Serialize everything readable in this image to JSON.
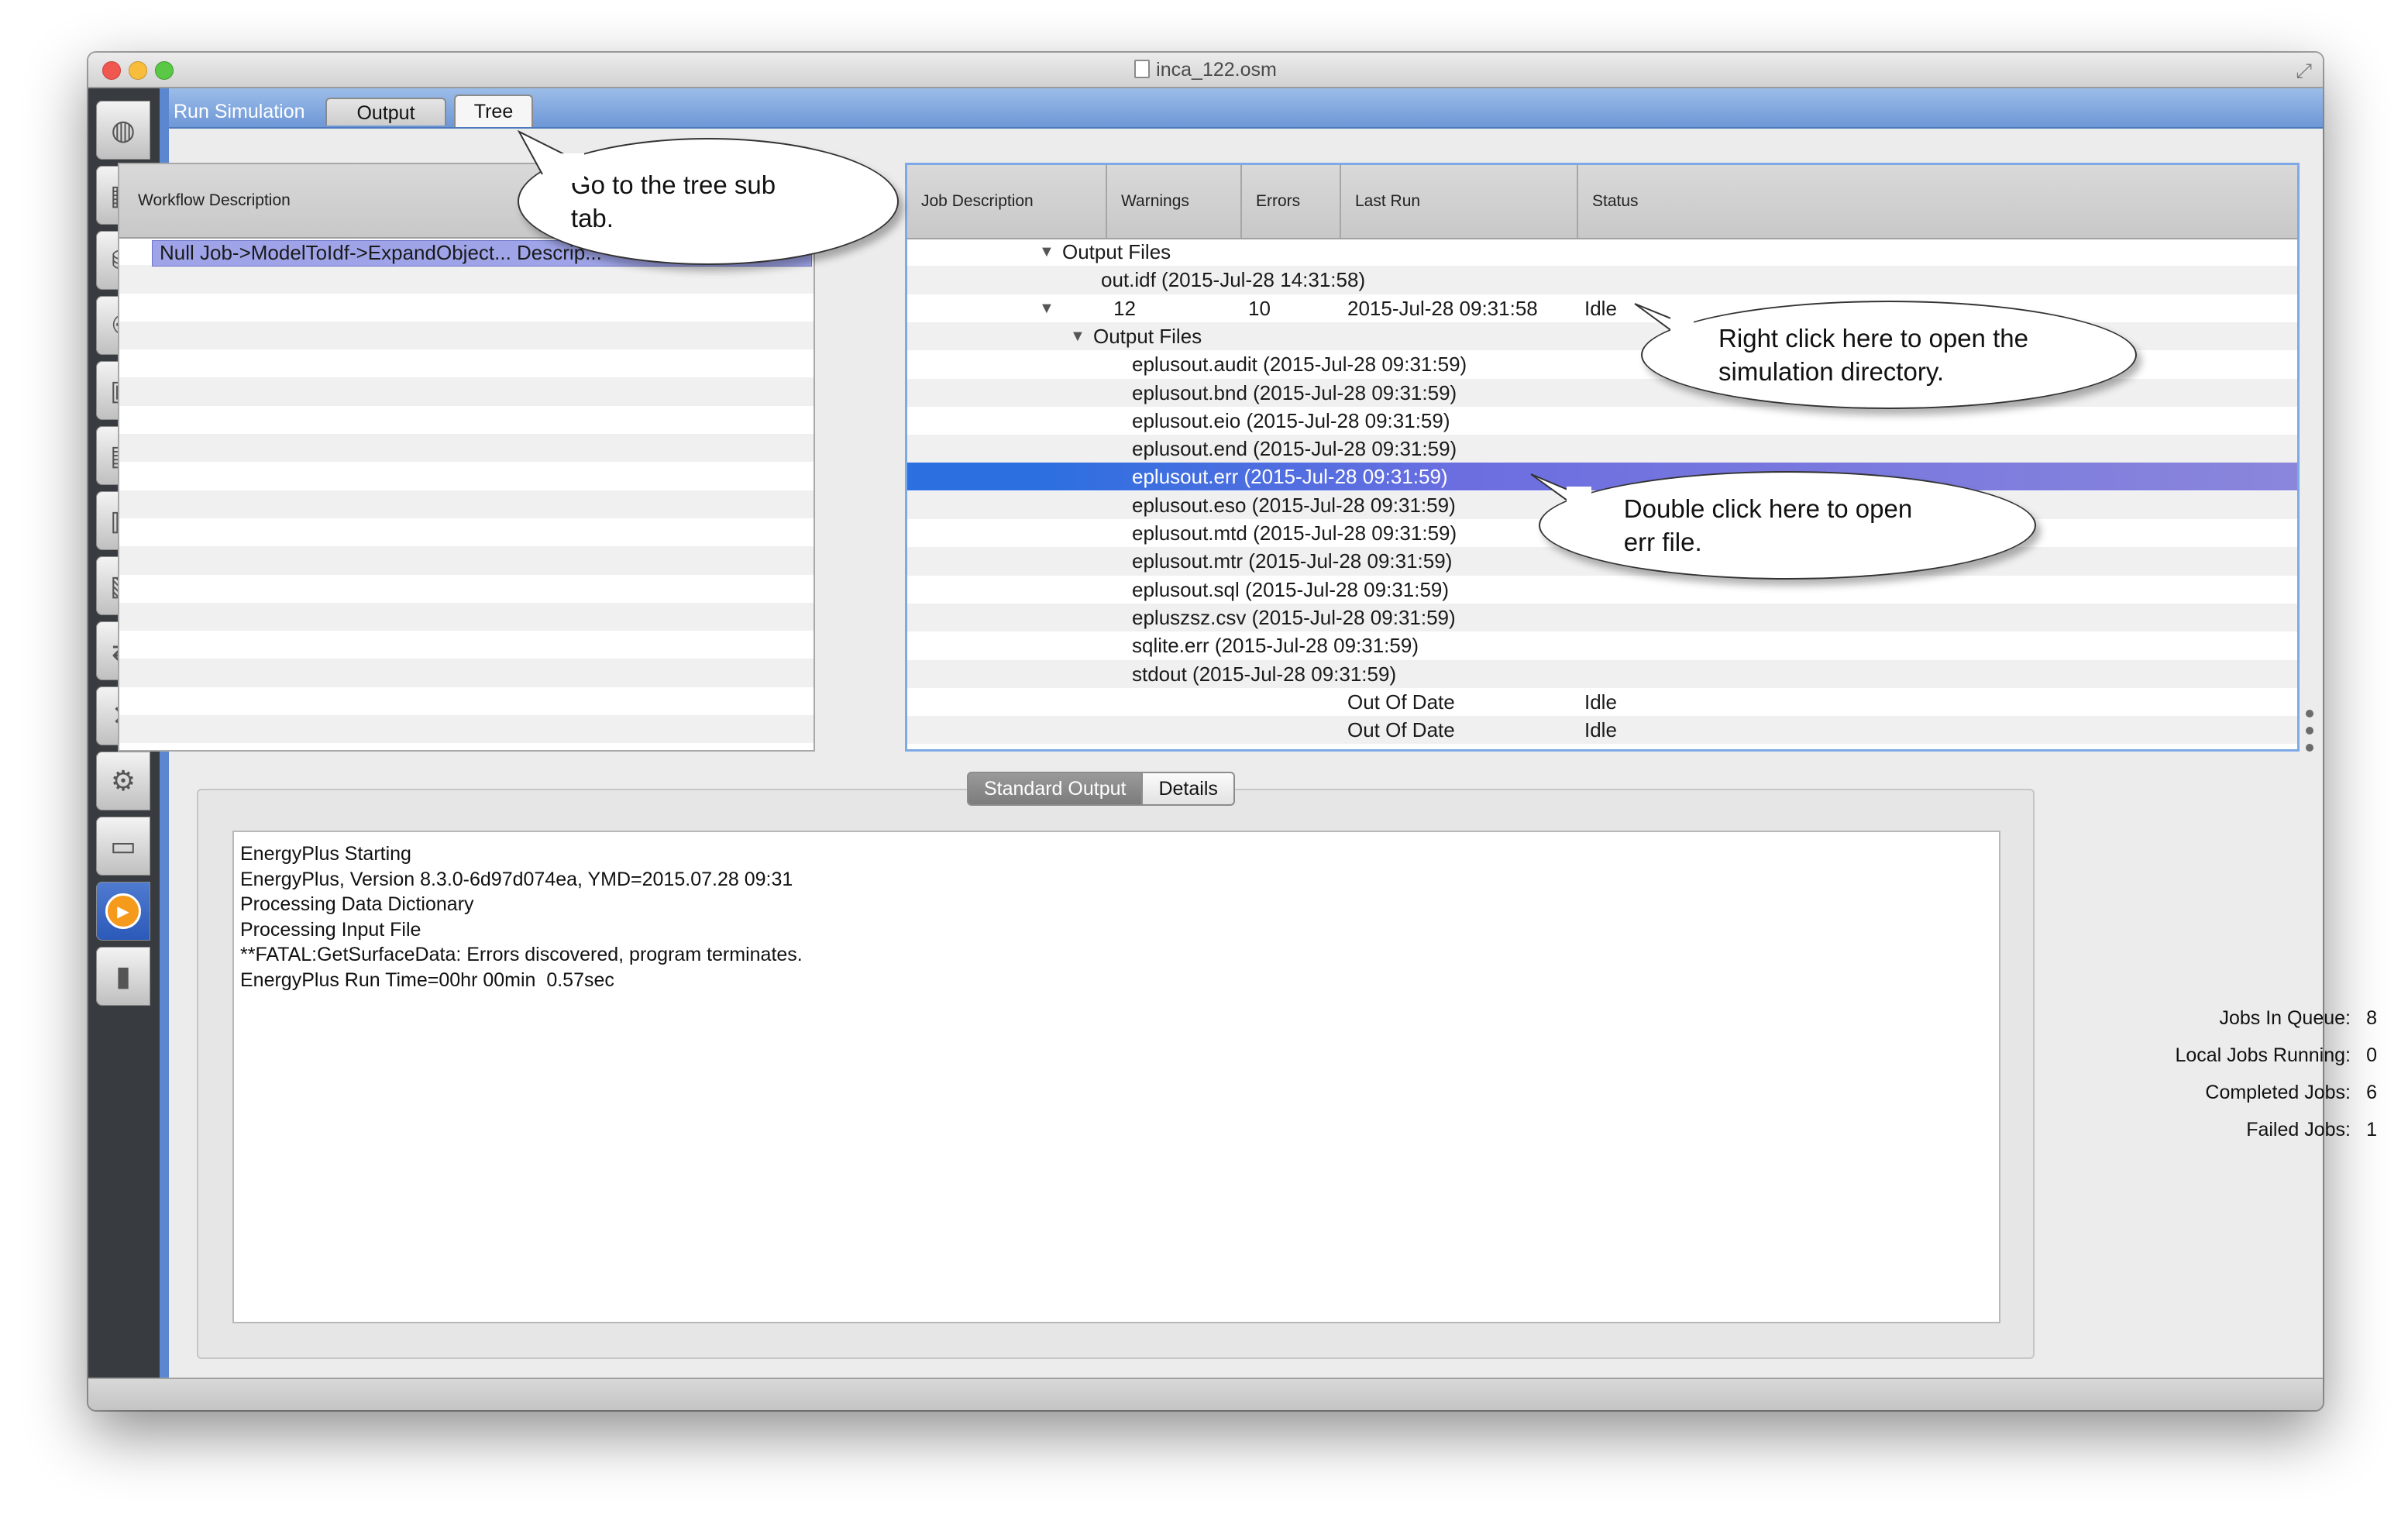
{
  "window": {
    "title": "inca_122.osm"
  },
  "tabs": {
    "run_simulation": "Run Simulation",
    "output": "Output",
    "tree": "Tree"
  },
  "sidebar": {
    "items": [
      {
        "icon": "globe-icon"
      },
      {
        "icon": "calendar-icon"
      },
      {
        "icon": "constructions-icon"
      },
      {
        "icon": "loads-icon"
      },
      {
        "icon": "space-types-icon"
      },
      {
        "icon": "facility-icon"
      },
      {
        "icon": "building-stories-icon"
      },
      {
        "icon": "thermal-zones-icon"
      },
      {
        "icon": "hvac-icon"
      },
      {
        "icon": "variables-icon"
      },
      {
        "icon": "settings-gear-icon"
      },
      {
        "icon": "scripts-icon"
      },
      {
        "icon": "run-simulation-icon"
      },
      {
        "icon": "results-chart-icon"
      }
    ]
  },
  "left_table": {
    "header": "Workflow Description",
    "selected_row": "Null Job->ModelToIdf->ExpandObject... Descrip..."
  },
  "right_table": {
    "headers": {
      "job_description": "Job Description",
      "warnings": "Warnings",
      "errors": "Errors",
      "last_run": "Last Run",
      "status": "Status"
    },
    "rows": [
      {
        "indent": 1,
        "expander": true,
        "desc": "Output Files",
        "warnings": "",
        "errors": "",
        "last_run": "",
        "status": ""
      },
      {
        "indent": 2,
        "expander": false,
        "desc": "out.idf (2015-Jul-28 14:31:58)",
        "warnings": "",
        "errors": "",
        "last_run": "",
        "status": ""
      },
      {
        "indent": 1,
        "expander": true,
        "desc": "",
        "warnings": "12",
        "errors": "10",
        "last_run": "2015-Jul-28 09:31:58",
        "status": "Idle"
      },
      {
        "indent": 2,
        "expander": true,
        "desc": "Output Files",
        "warnings": "",
        "errors": "",
        "last_run": "",
        "status": ""
      },
      {
        "indent": 3,
        "expander": false,
        "desc": "eplusout.audit (2015-Jul-28 09:31:59)",
        "warnings": "",
        "errors": "",
        "last_run": "",
        "status": ""
      },
      {
        "indent": 3,
        "expander": false,
        "desc": "eplusout.bnd (2015-Jul-28 09:31:59)",
        "warnings": "",
        "errors": "",
        "last_run": "",
        "status": ""
      },
      {
        "indent": 3,
        "expander": false,
        "desc": "eplusout.eio (2015-Jul-28 09:31:59)",
        "warnings": "",
        "errors": "",
        "last_run": "",
        "status": ""
      },
      {
        "indent": 3,
        "expander": false,
        "desc": "eplusout.end (2015-Jul-28 09:31:59)",
        "warnings": "",
        "errors": "",
        "last_run": "",
        "status": ""
      },
      {
        "indent": 3,
        "expander": false,
        "desc": "eplusout.err (2015-Jul-28 09:31:59)",
        "warnings": "",
        "errors": "",
        "last_run": "",
        "status": "",
        "selected": true
      },
      {
        "indent": 3,
        "expander": false,
        "desc": "eplusout.eso (2015-Jul-28 09:31:59)",
        "warnings": "",
        "errors": "",
        "last_run": "",
        "status": ""
      },
      {
        "indent": 3,
        "expander": false,
        "desc": "eplusout.mtd (2015-Jul-28 09:31:59)",
        "warnings": "",
        "errors": "",
        "last_run": "",
        "status": ""
      },
      {
        "indent": 3,
        "expander": false,
        "desc": "eplusout.mtr (2015-Jul-28 09:31:59)",
        "warnings": "",
        "errors": "",
        "last_run": "",
        "status": ""
      },
      {
        "indent": 3,
        "expander": false,
        "desc": "eplusout.sql (2015-Jul-28 09:31:59)",
        "warnings": "",
        "errors": "",
        "last_run": "",
        "status": ""
      },
      {
        "indent": 3,
        "expander": false,
        "desc": "epluszsz.csv (2015-Jul-28 09:31:59)",
        "warnings": "",
        "errors": "",
        "last_run": "",
        "status": ""
      },
      {
        "indent": 3,
        "expander": false,
        "desc": "sqlite.err (2015-Jul-28 09:31:59)",
        "warnings": "",
        "errors": "",
        "last_run": "",
        "status": ""
      },
      {
        "indent": 3,
        "expander": false,
        "desc": "stdout (2015-Jul-28 09:31:59)",
        "warnings": "",
        "errors": "",
        "last_run": "",
        "status": ""
      },
      {
        "indent": 1,
        "expander": false,
        "desc": "",
        "warnings": "",
        "errors": "",
        "last_run": "Out Of Date",
        "status": "Idle"
      },
      {
        "indent": 1,
        "expander": false,
        "desc": "",
        "warnings": "",
        "errors": "",
        "last_run": "Out Of Date",
        "status": "Idle"
      }
    ]
  },
  "output_tabs": {
    "standard_output": "Standard Output",
    "details": "Details"
  },
  "standard_output": {
    "lines": [
      "EnergyPlus Starting",
      "EnergyPlus, Version 8.3.0-6d97d074ea, YMD=2015.07.28 09:31",
      "Processing Data Dictionary",
      "Processing Input File",
      "**FATAL:GetSurfaceData: Errors discovered, program terminates.",
      "EnergyPlus Run Time=00hr 00min  0.57sec"
    ]
  },
  "stats": [
    {
      "label": "Jobs In Queue:",
      "value": "8"
    },
    {
      "label": "Local Jobs Running:",
      "value": "0"
    },
    {
      "label": "Completed Jobs:",
      "value": "6"
    },
    {
      "label": "Failed Jobs:",
      "value": "1"
    }
  ],
  "callouts": {
    "tree_tab": "Go to the tree sub\ntab.",
    "right_click": "Right click here to open the\nsimulation directory.",
    "double_click": "Double click here to open\nerr file."
  }
}
